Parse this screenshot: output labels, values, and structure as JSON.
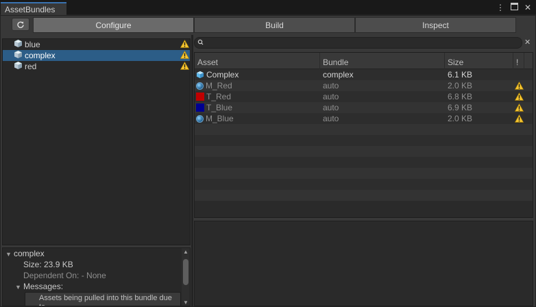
{
  "window": {
    "tab_title": "AssetBundles",
    "controls": [
      "kebab-menu-icon",
      "maximize-icon",
      "close-icon"
    ]
  },
  "toolbar": {
    "tabs": [
      {
        "label": "Configure",
        "active": true
      },
      {
        "label": "Build",
        "active": false
      },
      {
        "label": "Inspect",
        "active": false
      }
    ]
  },
  "bundles": [
    {
      "name": "blue",
      "selected": false,
      "warning": true
    },
    {
      "name": "complex",
      "selected": true,
      "warning": true
    },
    {
      "name": "red",
      "selected": false,
      "warning": true
    }
  ],
  "details": {
    "name": "complex",
    "size": "Size: 23.9 KB",
    "dependent_on": "Dependent On: - None",
    "messages_label": "Messages:",
    "message_text": "Assets being pulled into this bundle due to"
  },
  "search": {
    "value": "",
    "placeholder": ""
  },
  "table": {
    "headers": {
      "asset": "Asset",
      "bundle": "Bundle",
      "size": "Size",
      "warn": "!"
    },
    "rows": [
      {
        "icon": "prefab-cube-icon",
        "asset": "Complex",
        "bundle": "complex",
        "size": "6.1 KB",
        "warning": false,
        "dim": false
      },
      {
        "icon": "material-sphere-icon",
        "asset": "M_Red",
        "bundle": "auto",
        "size": "2.0 KB",
        "warning": true,
        "dim": true
      },
      {
        "icon": "texture-swatch-icon",
        "swatch": "#c00000",
        "asset": "T_Red",
        "bundle": "auto",
        "size": "6.8 KB",
        "warning": true,
        "dim": true
      },
      {
        "icon": "texture-swatch-icon",
        "swatch": "#000090",
        "asset": "T_Blue",
        "bundle": "auto",
        "size": "6.9 KB",
        "warning": true,
        "dim": true
      },
      {
        "icon": "material-sphere-icon",
        "asset": "M_Blue",
        "bundle": "auto",
        "size": "2.0 KB",
        "warning": true,
        "dim": true
      }
    ]
  },
  "colors": {
    "selection": "#2c5d87",
    "warning": "#f4c430",
    "accent_tab": "#3a72b0"
  }
}
